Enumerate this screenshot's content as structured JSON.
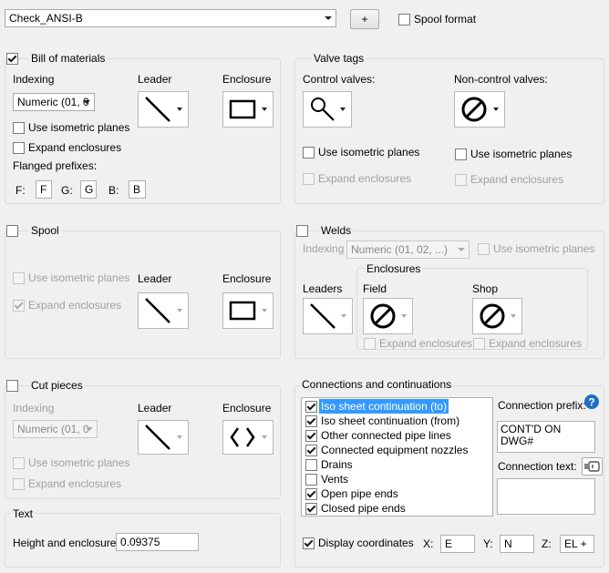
{
  "top": {
    "style_value": "Check_ANSI-B",
    "add_label": "+",
    "spool_format_label": "Spool format",
    "spool_format_checked": false
  },
  "bom": {
    "title": "Bill of materials",
    "checked": true,
    "indexing_label": "Indexing",
    "indexing_value": "Numeric (01, 0",
    "leader_label": "Leader",
    "enclosure_label": "Enclosure",
    "iso_planes_label": "Use isometric planes",
    "expand_label": "Expand enclosures",
    "flanged_label": "Flanged prefixes:",
    "f_label": "F:",
    "f_value": "F",
    "g_label": "G:",
    "g_value": "G",
    "b_label": "B:",
    "b_value": "B"
  },
  "valve": {
    "title": "Valve tags",
    "control_label": "Control valves:",
    "noncontrol_label": "Non-control valves:",
    "iso_planes_label": "Use isometric planes",
    "expand_label": "Expand enclosures"
  },
  "spool": {
    "title": "Spool",
    "checked": false,
    "iso_planes_label": "Use isometric planes",
    "expand_label": "Expand enclosures",
    "leader_label": "Leader",
    "enclosure_label": "Enclosure"
  },
  "welds": {
    "title": "Welds",
    "checked": false,
    "indexing_label": "Indexing",
    "indexing_value": "Numeric (01, 02, ...)",
    "iso_planes_label": "Use isometric planes",
    "enclosures_label": "Enclosures",
    "leaders_label": "Leaders",
    "field_label": "Field",
    "shop_label": "Shop",
    "expand_label": "Expand enclosures"
  },
  "cut": {
    "title": "Cut pieces",
    "checked": false,
    "indexing_label": "Indexing",
    "indexing_value": "Numeric (01, 0",
    "leader_label": "Leader",
    "enclosure_label": "Enclosure",
    "iso_planes_label": "Use isometric planes",
    "expand_label": "Expand enclosures"
  },
  "text": {
    "title": "Text",
    "height_label": "Height and enclosure:",
    "height_value": "0.09375"
  },
  "conn": {
    "title": "Connections and continuations",
    "items": [
      {
        "label": "Iso sheet continuation (to)",
        "checked": true,
        "selected": true
      },
      {
        "label": "Iso sheet continuation (from)",
        "checked": true,
        "selected": false
      },
      {
        "label": "Other connected pipe lines",
        "checked": true,
        "selected": false
      },
      {
        "label": "Connected equipment nozzles",
        "checked": true,
        "selected": false
      },
      {
        "label": "Drains",
        "checked": false,
        "selected": false
      },
      {
        "label": "Vents",
        "checked": false,
        "selected": false
      },
      {
        "label": "Open pipe ends",
        "checked": true,
        "selected": false
      },
      {
        "label": "Closed pipe ends",
        "checked": true,
        "selected": false
      }
    ],
    "prefix_label": "Connection prefix:",
    "prefix_line1": "CONT'D ON",
    "prefix_line2": "DWG#",
    "text_label": "Connection text:",
    "display_coords_label": "Display coordinates",
    "display_coords_checked": true,
    "x_label": "X:",
    "x_value": "E",
    "y_label": "Y:",
    "y_value": "N",
    "z_label": "Z:",
    "z_value": "EL +"
  }
}
